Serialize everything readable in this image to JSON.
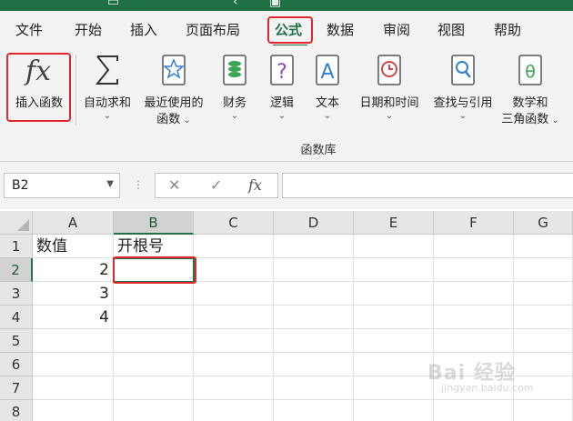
{
  "ribbon_tabs": [
    "文件",
    "开始",
    "插入",
    "页面布局",
    "公式",
    "数据",
    "审阅",
    "视图",
    "帮助"
  ],
  "active_tab": "公式",
  "ribbon_buttons": {
    "insert_function": "插入函数",
    "autosum": "自动求和",
    "recent_line1": "最近使用的",
    "recent_line2": "函数",
    "financial": "财务",
    "logical": "逻辑",
    "text": "文本",
    "datetime": "日期和时间",
    "lookup": "查找与引用",
    "math_line1": "数学和",
    "math_line2": "三角函数"
  },
  "group_label": "函数库",
  "formula_bar": {
    "name_box": "B2",
    "cancel": "✕",
    "enter": "✓",
    "fx": "fx",
    "formula": ""
  },
  "sheet": {
    "columns": [
      "A",
      "B",
      "C",
      "D",
      "E",
      "F",
      "G"
    ],
    "rows": [
      "1",
      "2",
      "3",
      "4",
      "5",
      "6",
      "7",
      "8"
    ],
    "cells": {
      "A1": "数值",
      "B1": "开根号",
      "A2": "2",
      "A3": "3",
      "A4": "4"
    },
    "active_cell": "B2"
  },
  "watermark": {
    "main": "Bai 经验",
    "sub": "jingyan.baidu.com"
  },
  "colors": {
    "accent_green": "#217346",
    "title_green": "#1f7145",
    "highlight_red": "#e3262b"
  }
}
